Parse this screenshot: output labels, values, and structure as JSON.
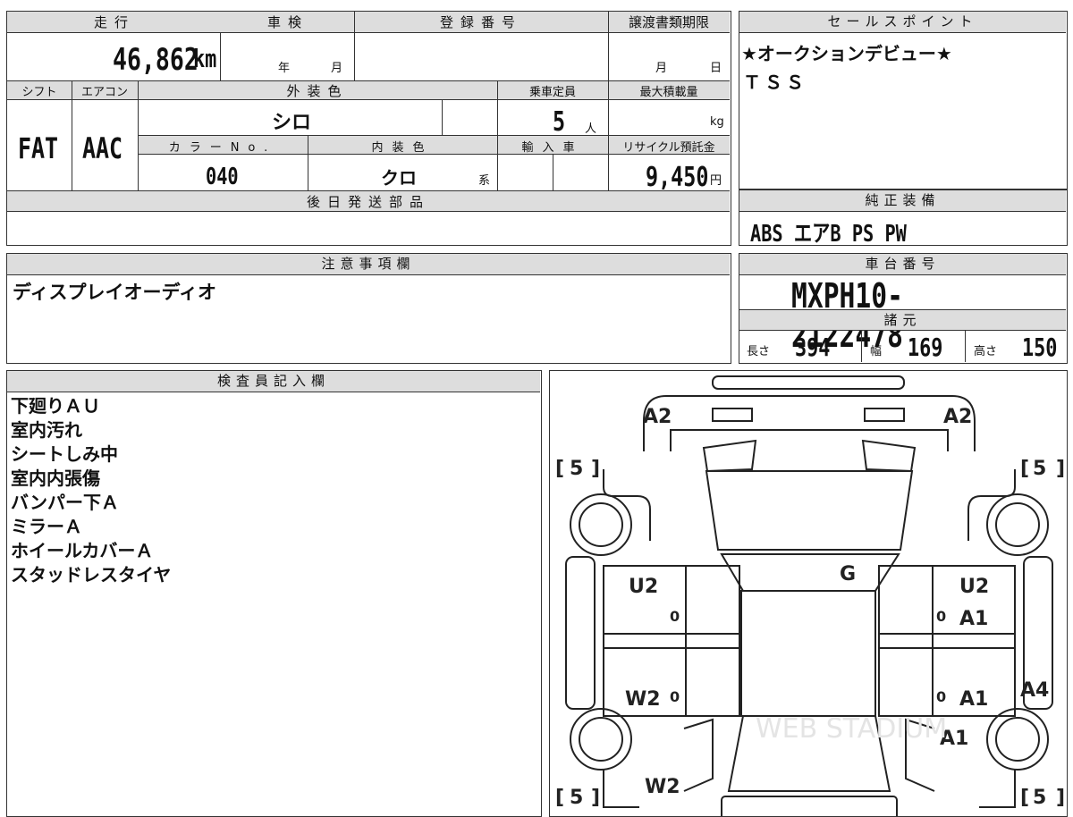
{
  "vehicle_info": {
    "mileage_label": "走行",
    "mileage": "46,862",
    "mileage_unit": "km",
    "shaken_label": "車検",
    "shaken_year_unit": "年",
    "shaken_month_unit": "月",
    "registration_label": "登録番号",
    "transfer_deadline_label": "譲渡書類期限",
    "transfer_month_unit": "月",
    "transfer_day_unit": "日",
    "shift_label": "シフト",
    "shift": "FAT",
    "aircon_label": "エアコン",
    "aircon": "AAC",
    "exterior_color_label": "外装色",
    "exterior_color": "シロ",
    "capacity_label": "乗車定員",
    "capacity": "5",
    "capacity_unit": "人",
    "max_load_label": "最大積載量",
    "max_load_unit": "kg",
    "color_no_label": "カラーNo.",
    "color_no": "040",
    "interior_color_label": "内装色",
    "interior_color": "クロ",
    "interior_color_suffix": "系",
    "import_label": "輸入車",
    "recycle_label": "リサイクル預託金",
    "recycle_fee": "9,450",
    "recycle_unit": "円",
    "later_parts_label": "後日発送部品"
  },
  "sales_points": {
    "label": "セールスポイント",
    "lines": [
      "★オークションデビュー★",
      "ＴＳＳ"
    ]
  },
  "equipment": {
    "label": "純正装備",
    "value": "ABS エアB PS PW"
  },
  "caution": {
    "label": "注意事項欄",
    "text": "ディスプレイオーディオ"
  },
  "chassis": {
    "label": "車台番号",
    "number": "MXPH10-2122478",
    "spec_label": "諸元",
    "length_label": "長さ",
    "length": "394",
    "width_label": "幅",
    "width": "169",
    "height_label": "高さ",
    "height": "150"
  },
  "inspector": {
    "label": "検査員記入欄",
    "notes": [
      "下廻りＡＵ",
      "室内汚れ",
      "シートしみ中",
      "室内内張傷",
      "バンパー下Ａ",
      "ミラーＡ",
      "ホイールカバーＡ",
      "スタッドレスタイヤ"
    ]
  },
  "diagram": {
    "marks": {
      "front_left": "A2",
      "front_right": "A2",
      "tire_fl": "5",
      "tire_fr": "5",
      "tire_rl": "5",
      "tire_rr": "5",
      "windshield": "G",
      "left_front_door": "U2",
      "right_front_door": "U2",
      "right_front_door_b": "A1",
      "left_rear_door": "W2",
      "right_rear_door": "A1",
      "right_side": "A4",
      "right_rear_fender": "A1",
      "left_rear_fender": "W2",
      "zero_mark": "0"
    },
    "watermark": "WEB STADIUM"
  }
}
